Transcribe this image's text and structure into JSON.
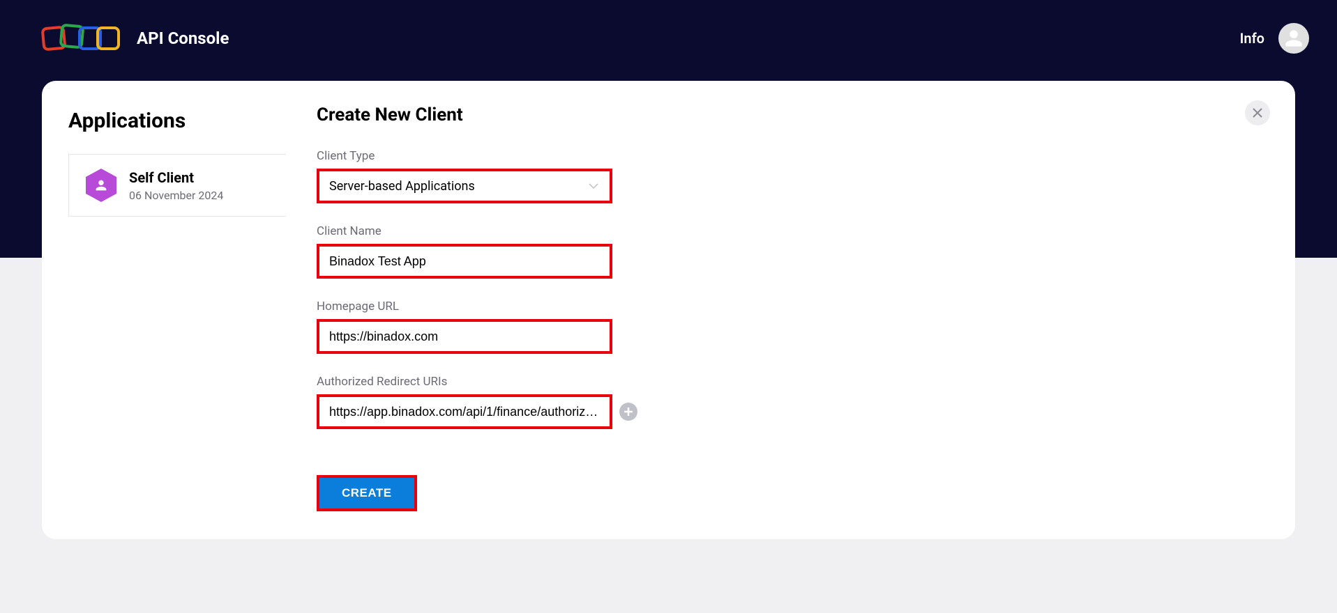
{
  "header": {
    "app_title": "API Console",
    "info_link": "Info"
  },
  "sidebar": {
    "title": "Applications",
    "items": [
      {
        "name": "Self Client",
        "date": "06 November 2024"
      }
    ]
  },
  "form": {
    "title": "Create New Client",
    "client_type": {
      "label": "Client Type",
      "value": "Server-based Applications"
    },
    "client_name": {
      "label": "Client Name",
      "value": "Binadox Test App"
    },
    "homepage_url": {
      "label": "Homepage URL",
      "value": "https://binadox.com"
    },
    "redirect_uris": {
      "label": "Authorized Redirect URIs",
      "value": "https://app.binadox.com/api/1/finance/authorize…"
    },
    "create_button": "CREATE"
  }
}
